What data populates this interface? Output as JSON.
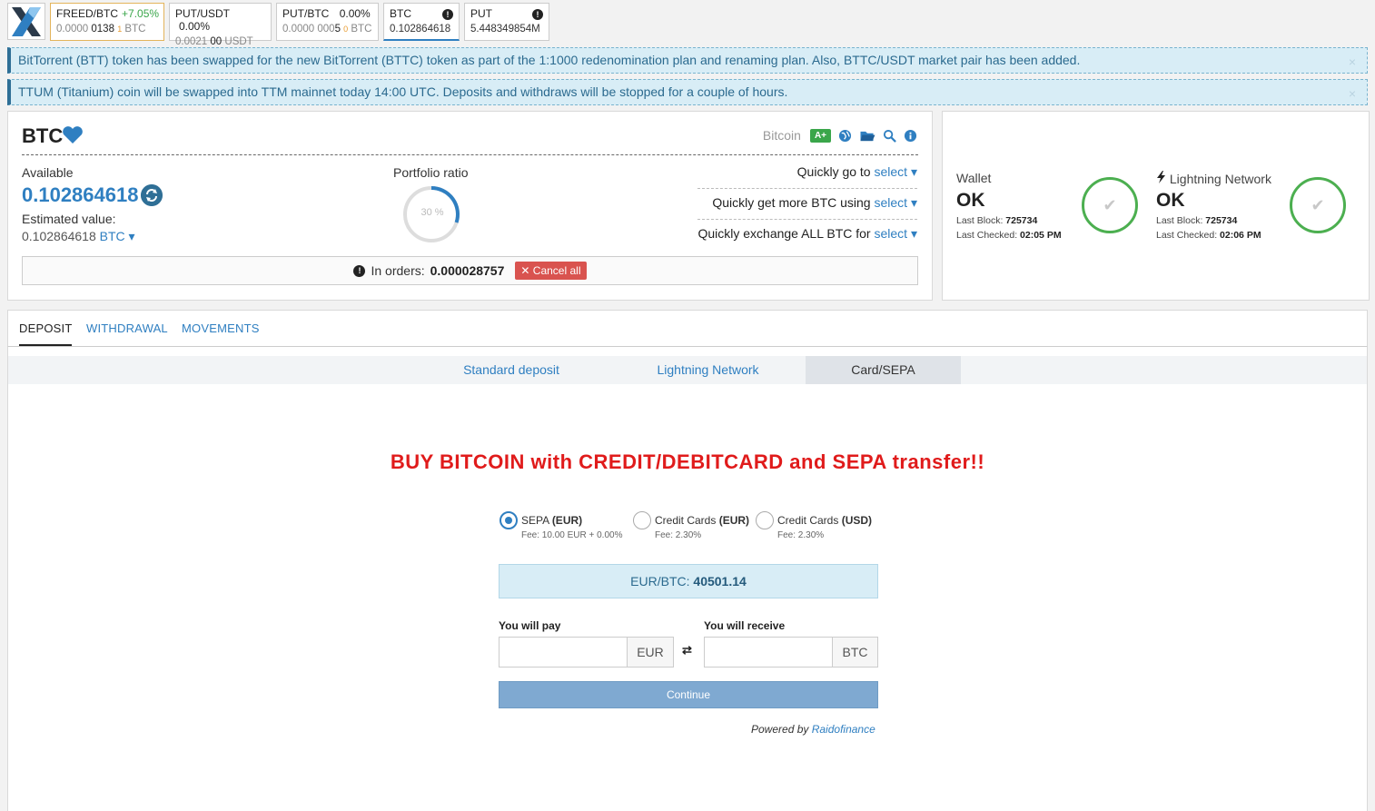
{
  "tickers": [
    {
      "pair_base": "FREED",
      "pair_quote": "/BTC",
      "change": "+7.05%",
      "change_color": "#3aa64a",
      "price_dim": "0.0000",
      "price_main": "0138",
      "price_small": "1",
      "unit": "BTC"
    },
    {
      "pair_base": "PUT",
      "pair_quote": "/USDT",
      "change": "0.00%",
      "price_dim": "0.0021",
      "price_main": "00",
      "unit": "USDT"
    },
    {
      "pair_base": "PUT",
      "pair_quote": "/BTC",
      "change": "0.00%",
      "price_dim": "0.0000 000",
      "price_main": "5",
      "price_small": "0",
      "unit": "BTC"
    },
    {
      "label": "BTC",
      "value": "0.102864618"
    },
    {
      "label": "PUT",
      "value": "5.448349854M"
    }
  ],
  "notices": [
    {
      "text": "BitTorrent (BTT) token has been swapped for the new BitTorrent (BTTC) token as part of the 1:1000 redenomination plan and renaming plan. Also, BTTC/USDT market pair has been added.",
      "close": "×"
    },
    {
      "text": "TTUM (Titanium) coin will be swapped into TTM mainnet today 14:00 UTC. Deposits and withdraws will be stopped for a couple of hours.",
      "close": "×"
    }
  ],
  "coin": {
    "symbol": "BTC",
    "name": "Bitcoin",
    "rating": "A+",
    "available_label": "Available",
    "available_value": "0.102864618",
    "estimated_label": "Estimated value:",
    "estimated_value": "0.102864618",
    "estimated_unit": "BTC",
    "portfolio_label": "Portfolio ratio",
    "portfolio_pct": "30 %",
    "portfolio_ratio": 0.3,
    "quick_go": "Quickly go to",
    "quick_more": "Quickly get more BTC using",
    "quick_exchange": "Quickly exchange ALL BTC for",
    "select": "select",
    "in_orders_label": "In orders:",
    "in_orders_value": "0.000028757",
    "cancel_all": "Cancel all"
  },
  "wallet": {
    "wallet_label": "Wallet",
    "wallet_status": "OK",
    "wallet_last_block_label": "Last Block:",
    "wallet_last_block": "725734",
    "wallet_last_checked_label": "Last Checked:",
    "wallet_last_checked": "02:05 PM",
    "ln_label": "Lightning Network",
    "ln_status": "OK",
    "ln_last_block_label": "Last Block:",
    "ln_last_block": "725734",
    "ln_last_checked_label": "Last Checked:",
    "ln_last_checked": "02:06 PM"
  },
  "tabs": [
    "DEPOSIT",
    "WITHDRAWAL",
    "MOVEMENTS"
  ],
  "subtabs": [
    "Standard deposit",
    "Lightning Network",
    "Card/SEPA"
  ],
  "headline": "BUY BITCOIN with CREDIT/DEBITCARD and SEPA transfer!!",
  "payment_options": [
    {
      "name": "SEPA",
      "currency": "(EUR)",
      "fee": "Fee: 10.00 EUR + 0.00%",
      "selected": true
    },
    {
      "name": "Credit Cards",
      "currency": "(EUR)",
      "fee": "Fee: 2.30%",
      "selected": false
    },
    {
      "name": "Credit Cards",
      "currency": "(USD)",
      "fee": "Fee: 2.30%",
      "selected": false
    }
  ],
  "rate": {
    "label": "EUR/BTC:",
    "value": "40501.14"
  },
  "form": {
    "pay_label": "You will pay",
    "pay_currency": "EUR",
    "receive_label": "You will receive",
    "receive_currency": "BTC",
    "continue": "Continue"
  },
  "powered": {
    "text": "Powered by",
    "link": "Raidofinance"
  },
  "colors": {
    "accent": "#2f7fc1",
    "headline": "#e01b1b",
    "ok_green": "#4caf50",
    "cancel_red": "#d9534f"
  }
}
